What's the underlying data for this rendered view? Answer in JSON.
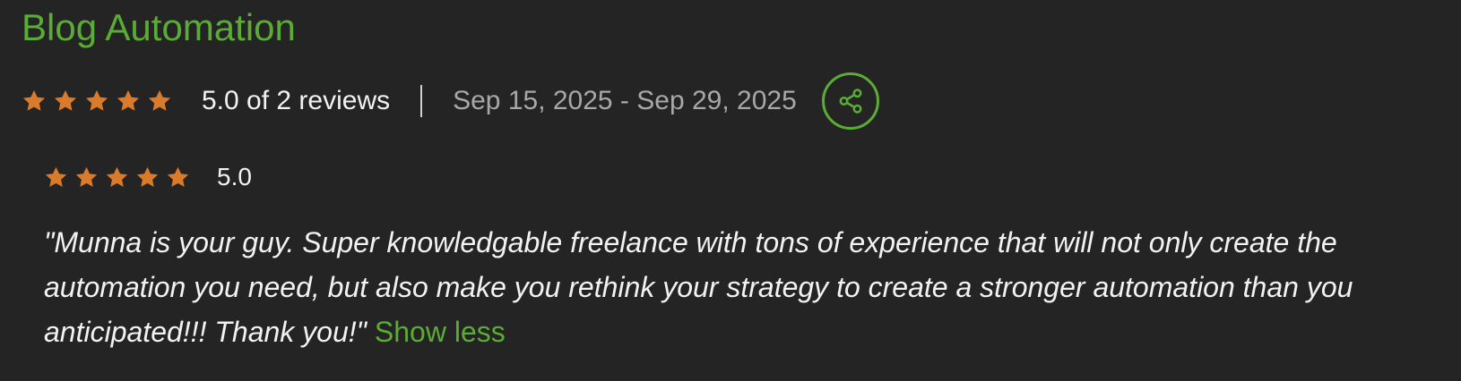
{
  "project": {
    "title": "Blog Automation"
  },
  "summary": {
    "rating_value": 5.0,
    "rating_text": "5.0 of 2 reviews",
    "date_range": "Sep 15, 2025 - Sep 29, 2025"
  },
  "review": {
    "rating_value": 5.0,
    "score_text": "5.0",
    "quote": "\"Munna is your guy. Super knowledgable freelance with tons of experience that will not only create the automation you need, but also make you rethink your strategy to create a stronger automation than you anticipated!!! Thank you!\"",
    "toggle_label": "Show less"
  },
  "icons": {
    "star": "star-icon",
    "share": "share-icon"
  },
  "colors": {
    "accent_green": "#5aac35",
    "star_orange": "#d97b2b",
    "background": "#242424",
    "text_primary": "#f2f2f2",
    "text_muted": "#a8a8a8"
  }
}
